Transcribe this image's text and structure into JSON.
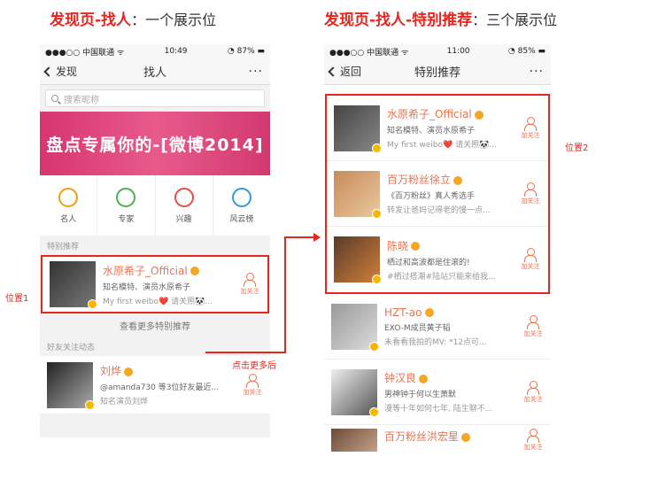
{
  "left_title": {
    "red": "发现页-找人",
    "sep": "：",
    "rest": "一个展示位"
  },
  "right_title": {
    "red": "发现页-找人-特别推荐",
    "sep": "：",
    "rest": "三个展示位"
  },
  "left_phone": {
    "status": {
      "carrier": "●●●○○ 中国联通 ᯤ",
      "time": "10:49",
      "battery": "◔ 87% ▬"
    },
    "nav": {
      "back": "发现",
      "title": "找人",
      "more": "···"
    },
    "search_placeholder": "搜索昵称",
    "banner": "盘点专属你的-[微博2014]",
    "categories": [
      {
        "label": "名人",
        "color": "#f39c12"
      },
      {
        "label": "专家",
        "color": "#4caf50"
      },
      {
        "label": "兴趣",
        "color": "#e74c3c"
      },
      {
        "label": "风云榜",
        "color": "#3498db"
      }
    ],
    "section_special": "特别推荐",
    "special_user": {
      "name": "水原希子_Official",
      "desc": "知名模特、演员水原希子",
      "post": "My first weibo❤️ 请关照🐼...",
      "follow": "加关注"
    },
    "see_more": "查看更多特别推荐",
    "section_friends": "好友关注动态",
    "friend_user": {
      "name": "刘烨",
      "desc": "@amanda730 等3位好友最近...",
      "post": "知名演员刘烨",
      "follow": "加关注"
    }
  },
  "right_phone": {
    "status": {
      "carrier": "●●●○○ 中国联通 ᯤ",
      "time": "11:00",
      "battery": "◔ 85% ▬"
    },
    "nav": {
      "back": "返回",
      "title": "特别推荐",
      "more": "···"
    },
    "users": [
      {
        "name": "水原希子_Official",
        "desc": "知名模特、演员水原希子",
        "post": "My first weibo❤️ 请关照🐼...",
        "follow": "加关注"
      },
      {
        "name": "百万粉丝徐立",
        "desc": "《百万粉丝》真人秀选手",
        "post": "转发让爸妈记得老的慢一点...",
        "follow": "加关注"
      },
      {
        "name": "陈晓",
        "desc": "栖过和高波都是住滚的!",
        "post": "#栖过搭潮#陆站只能来给我...",
        "follow": "加关注"
      },
      {
        "name": "HZT-ao",
        "desc": "EXO-M成员黄子韬",
        "post": "未看看我拍的MV: *12点可...",
        "follow": "加关注"
      },
      {
        "name": "钟汉良",
        "desc": "男神钟于何以生萧默",
        "post": "漫等十年如何七年, 陆生聊不...",
        "follow": "加关注"
      },
      {
        "name": "百万粉丝洪宏星",
        "desc": "",
        "post": "",
        "follow": "加关注"
      }
    ]
  },
  "annotations": {
    "pos1": "位置1",
    "pos2": "位置2",
    "click_more": "点击更多后"
  }
}
